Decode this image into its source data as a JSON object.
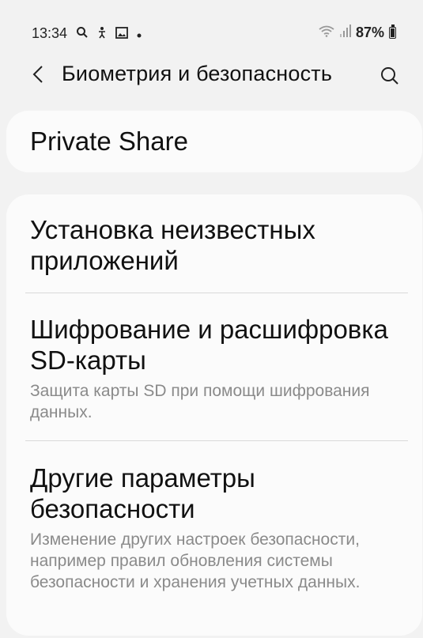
{
  "status_bar": {
    "time": "13:34",
    "battery": "87%"
  },
  "header": {
    "title": "Биометрия и безопасность"
  },
  "items": [
    {
      "title": "Private Share"
    },
    {
      "title": "Установка неизвестных приложений"
    },
    {
      "title": "Шифрование и расшифровка SD-карты",
      "subtitle": "Защита карты SD при помощи шифрования данных."
    },
    {
      "title": "Другие параметры безопасности",
      "subtitle": "Изменение других настроек безопасности, например правил обновления системы безопасности и хранения учетных данных."
    }
  ]
}
